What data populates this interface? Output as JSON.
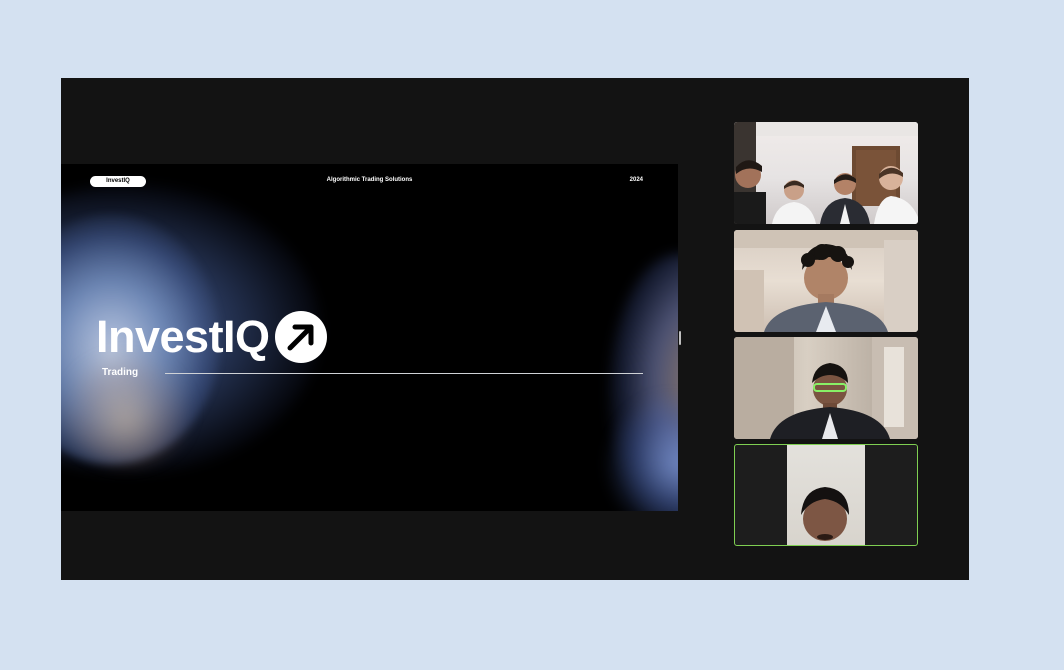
{
  "slide": {
    "badge": "InvestIQ",
    "center_title": "Algorithmic Trading Solutions",
    "year": "2024",
    "logo_text": "InvestIQ",
    "subtitle": "Trading"
  },
  "participants": [
    {
      "tile": "participant-video-1",
      "active_speaker": false
    },
    {
      "tile": "participant-video-2",
      "active_speaker": false
    },
    {
      "tile": "participant-video-3",
      "active_speaker": false
    },
    {
      "tile": "participant-video-4",
      "active_speaker": true
    }
  ],
  "colors": {
    "page_background": "#d4e1f1",
    "meeting_background": "#131313",
    "active_speaker_border": "#7fcf52"
  },
  "icons": {
    "logo_arrow": "arrow-up-right-icon"
  }
}
